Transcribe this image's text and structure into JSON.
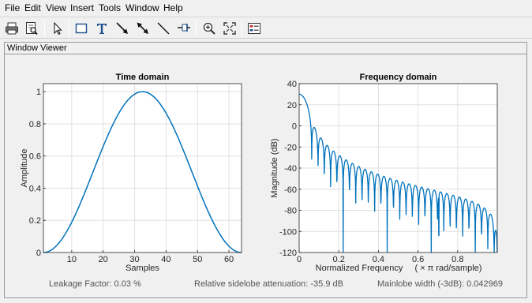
{
  "menubar": {
    "items": [
      "File",
      "Edit",
      "View",
      "Insert",
      "Tools",
      "Window",
      "Help"
    ]
  },
  "toolbar": {
    "tools": [
      "print-icon",
      "print-preview-icon",
      "select-arrow-icon",
      "insert-rectangle-icon",
      "insert-text-icon",
      "insert-arrow-icon",
      "insert-double-arrow-icon",
      "insert-line-icon",
      "pin-icon",
      "zoom-in-icon",
      "full-view-icon",
      "legend-icon"
    ]
  },
  "panel": {
    "title": "Window Viewer"
  },
  "status": {
    "leakage": "Leakage Factor: 0.03 %",
    "sidelobe": "Relative sidelobe attenuation: -35.9 dB",
    "mainlobe": "Mainlobe width (-3dB): 0.042969"
  },
  "colors": {
    "line": "#0072bd",
    "grid": "#e0e0e0",
    "axis": "#262626"
  },
  "chart_data": [
    {
      "type": "line",
      "title": "Time domain",
      "xlabel": "Samples",
      "ylabel": "Amplitude",
      "xlim": [
        1,
        64
      ],
      "ylim": [
        0,
        1.05
      ],
      "xticks": [
        10,
        20,
        30,
        40,
        50,
        60
      ],
      "yticks": [
        0,
        0.2,
        0.4,
        0.6,
        0.8,
        1
      ],
      "ytick_labels": [
        "0",
        "0.2",
        "0.4",
        "0.6",
        "0.8",
        "1"
      ],
      "grid": true,
      "window_length": 64,
      "peak": {
        "x": 32.5,
        "y": 1
      }
    },
    {
      "type": "line",
      "title": "Frequency domain",
      "xlabel_main": "Normalized  Frequency",
      "xlabel_unit": "( × π  rad/sample)",
      "ylabel": "Magnitude (dB)",
      "xlim": [
        0,
        1
      ],
      "ylim": [
        -120,
        40
      ],
      "xticks": [
        0,
        0.2,
        0.4,
        0.6,
        0.8
      ],
      "xtick_labels": [
        "0",
        "0.2",
        "0.4",
        "0.6",
        "0.8"
      ],
      "yticks": [
        40,
        20,
        0,
        -20,
        -40,
        -60,
        -80,
        -100,
        -120
      ],
      "grid": true,
      "peak_db": 30,
      "sidelobe_level_db": -50,
      "deepest_null": {
        "x": 0.705,
        "y": -104
      }
    }
  ]
}
